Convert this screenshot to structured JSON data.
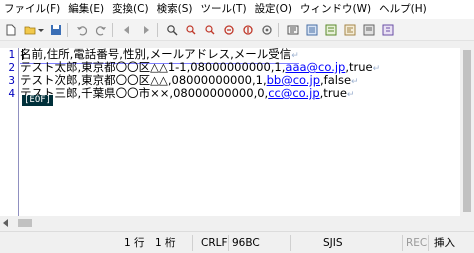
{
  "menu": [
    "ファイル(F)",
    "編集(E)",
    "変換(C)",
    "検索(S)",
    "ツール(T)",
    "設定(O)",
    "ウィンドウ(W)",
    "ヘルプ(H)"
  ],
  "toolbar": {
    "icons": [
      "new-file-icon",
      "open-folder-icon",
      "open-dropdown-icon",
      "save-icon",
      "undo-icon",
      "redo-icon",
      "back-icon",
      "forward-icon",
      "search-icon",
      "search-next-icon",
      "search-prev-icon",
      "replace-icon",
      "grep-icon",
      "compare-icon",
      "outline-icon",
      "settings-icon",
      "font-icon",
      "type-settings-icon",
      "common-settings-icon",
      "help-icon"
    ]
  },
  "editor": {
    "line_numbers": [
      "1",
      "2",
      "3",
      "4"
    ],
    "lines": [
      {
        "text": "名前,住所,電話番号,性別,メールアドレス,メール受信",
        "url": "",
        "tail": "",
        "eol": "↵"
      },
      {
        "text": "テスト太郎,東京都〇〇区△△1-1,08000000000,1,",
        "url": "aaa@co.jp",
        "tail": ",true",
        "eol": "↵"
      },
      {
        "text": "テスト次郎,東京都〇〇区△△,08000000000,1,",
        "url": "bb@co.jp",
        "tail": ",false",
        "eol": "↵"
      },
      {
        "text": "テスト三郎,千葉県〇〇市××,08000000000,0,",
        "url": "cc@co.jp",
        "tail": ",true",
        "eol": "↵"
      }
    ],
    "eof_marker": "[EOF]"
  },
  "status": {
    "line": "1 行",
    "column": "1 桁",
    "newline": "CRLF",
    "char_code": "96BC",
    "encoding": "SJIS",
    "rec": "REC",
    "mode": "挿入"
  }
}
